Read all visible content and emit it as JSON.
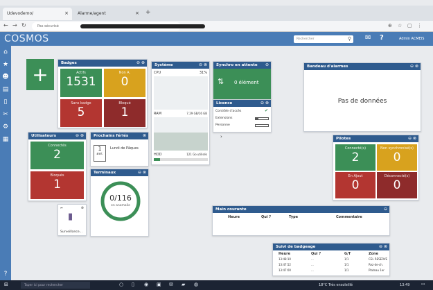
{
  "browser": {
    "tabs": [
      {
        "label": "Udevodemo/",
        "active": true
      },
      {
        "label": "Alarme/agent",
        "active": false
      }
    ],
    "url_prefix": "Pas sécurisé"
  },
  "app": {
    "logo": "COSMOS",
    "search_placeholder": "Rechercher",
    "user": "Admin ACMEIS"
  },
  "widgets": {
    "badges": {
      "title": "Badges",
      "tiles": [
        {
          "label": "Actifs",
          "value": "1531",
          "color": "#3c8f57"
        },
        {
          "label": "Non A.",
          "value": "0",
          "color": "#d8a21e"
        },
        {
          "label": "Sans badge",
          "value": "5",
          "color": "#b33631"
        },
        {
          "label": "Bloqué",
          "value": "1",
          "color": "#8e2b2b"
        }
      ]
    },
    "systeme": {
      "title": "Système",
      "cpu_label": "CPU",
      "cpu_value": "31%",
      "ram_label": "RAM",
      "ram_value": "7.29 GB/16 GB",
      "hdd_label": "HDD",
      "hdd_value": "121 Go utilisés"
    },
    "sync": {
      "title": "Synchro en attente",
      "value": "0 élément"
    },
    "licence": {
      "title": "Licence",
      "rows": [
        {
          "label": "Contrôle d'accès"
        },
        {
          "label": "Extensions"
        },
        {
          "label": "Personne"
        }
      ]
    },
    "bandeau": {
      "title": "Bandeau d'alarmes",
      "empty": "Pas de données"
    },
    "utilisateurs": {
      "title": "Utilisateurs",
      "tiles": [
        {
          "label": "Connectés",
          "value": "2",
          "color": "#3c8f57"
        },
        {
          "label": "Bloqués",
          "value": "1",
          "color": "#b33631"
        }
      ]
    },
    "feries": {
      "title": "Prochains fériés",
      "day": "1",
      "month": "avr.",
      "text": "Lundi de Pâques"
    },
    "terminaux": {
      "title": "Terminaux",
      "value": "0/116",
      "sub": "en anomalie",
      "ring_color": "#3c8f57"
    },
    "surveillance": {
      "label": "Surveillance..."
    },
    "pilotes": {
      "title": "Pilotes",
      "tiles": [
        {
          "label": "Connecté(s)",
          "value": "2",
          "color": "#3c8f57"
        },
        {
          "label": "Non synchronisé(s)",
          "value": "0",
          "color": "#d8a21e"
        },
        {
          "label": "En Ajout",
          "value": "0",
          "color": "#b33631"
        },
        {
          "label": "Déconnecté(s)",
          "value": "0",
          "color": "#8e2b2b"
        }
      ]
    },
    "main_courante": {
      "title": "Main courante",
      "columns": [
        "Heure",
        "Qui ?",
        "Type",
        "Commentaire"
      ]
    },
    "suivi": {
      "title": "Suivi de badgeage",
      "columns": [
        "Heure",
        "Qui ?",
        "G/T",
        "Zone"
      ],
      "rows": [
        [
          "13:48:10",
          "...",
          "1/1",
          "CEL RESERVE"
        ],
        [
          "13:47:52",
          "...",
          "1/1",
          "Rez-de-ch."
        ],
        [
          "13:47:00",
          "...",
          "1/1",
          "Plateau 1er"
        ]
      ]
    }
  },
  "taskbar": {
    "search_placeholder": "Taper ici pour rechercher",
    "weather": "18°C Très ensoleillé",
    "time": "13:49"
  }
}
